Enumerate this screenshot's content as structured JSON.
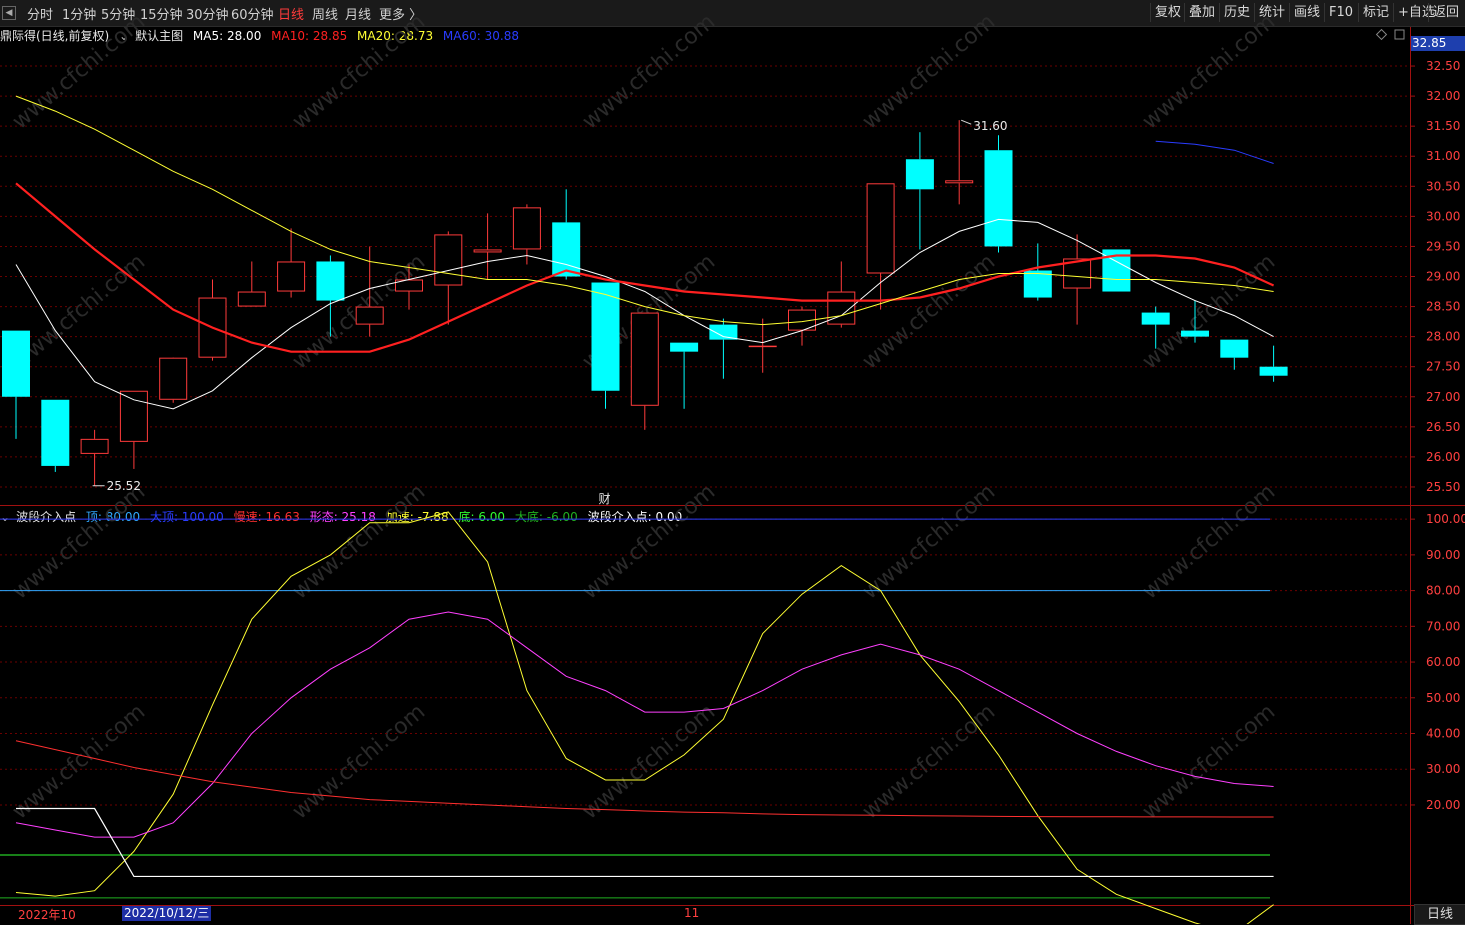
{
  "toolbar": {
    "periods": [
      "分时",
      "1分钟",
      "5分钟",
      "15分钟",
      "30分钟",
      "60分钟",
      "日线",
      "周线",
      "月线",
      "更多 〉"
    ],
    "active_period": "日线",
    "right_buttons": [
      "复权",
      "叠加",
      "历史",
      "统计",
      "画线",
      "F10",
      "标记",
      "+自选",
      "返回"
    ]
  },
  "main_legend": {
    "stock": "鼎际得(日线,前复权)",
    "template": "默认主图",
    "ma5": {
      "label": "MA5: 28.00",
      "color": "#ffffff"
    },
    "ma10": {
      "label": "MA10: 28.85",
      "color": "#ff2020"
    },
    "ma20": {
      "label": "MA20: 28.73",
      "color": "#ffff33"
    },
    "ma60": {
      "label": "MA60: 30.88",
      "color": "#2a3cff"
    }
  },
  "price_axis": {
    "current_price": "32.85",
    "ticks": [
      "32.50",
      "32.00",
      "31.50",
      "31.00",
      "30.50",
      "30.00",
      "29.50",
      "29.00",
      "28.50",
      "28.00",
      "27.50",
      "27.00",
      "26.50",
      "26.00",
      "25.50"
    ]
  },
  "annotations": {
    "high": "31.60",
    "low": "25.52",
    "finance_marker": "财"
  },
  "sub_legend": {
    "name": "波段介入点",
    "items": [
      {
        "label": "顶: 80.00",
        "color": "#30a8ff"
      },
      {
        "label": "大顶: 100.00",
        "color": "#2a3cff"
      },
      {
        "label": "慢速: 16.63",
        "color": "#ff3030"
      },
      {
        "label": "形态: 25.18",
        "color": "#ff40ff"
      },
      {
        "label": "加速: -7.88",
        "color": "#ffff33"
      },
      {
        "label": "底: 6.00",
        "color": "#30ff30"
      },
      {
        "label": "大底: -6.00",
        "color": "#20b020"
      },
      {
        "label": "波段介入点: 0.00",
        "color": "#ffffff"
      }
    ]
  },
  "sub_axis": {
    "ticks": [
      "100.00",
      "90.00",
      "80.00",
      "70.00",
      "60.00",
      "50.00",
      "40.00",
      "30.00",
      "20.00"
    ]
  },
  "date_axis": {
    "left_label": "2022年10",
    "cursor_date": "2022/10/12/三",
    "month_label": "11",
    "period_label": "日线"
  },
  "colors": {
    "up": "#ff3b3b",
    "down": "#00ffff",
    "grid": "#6b0000",
    "axis": "#a01010"
  },
  "watermark": "www.cfchi.com",
  "chart_data": [
    {
      "type": "candlestick",
      "title": "鼎际得(日线,前复权)",
      "ylim": [
        25.2,
        32.85
      ],
      "candles": [
        {
          "o": 28.1,
          "h": 28.1,
          "l": 26.3,
          "c": 27.0
        },
        {
          "o": 26.95,
          "h": 26.95,
          "l": 25.75,
          "c": 25.85
        },
        {
          "o": 26.05,
          "h": 26.45,
          "l": 25.52,
          "c": 26.3
        },
        {
          "o": 26.25,
          "h": 27.1,
          "l": 25.8,
          "c": 27.1
        },
        {
          "o": 26.95,
          "h": 27.6,
          "l": 26.9,
          "c": 27.65
        },
        {
          "o": 27.65,
          "h": 28.95,
          "l": 27.6,
          "c": 28.65
        },
        {
          "o": 28.5,
          "h": 29.25,
          "l": 28.5,
          "c": 28.75
        },
        {
          "o": 28.75,
          "h": 29.8,
          "l": 28.65,
          "c": 29.25
        },
        {
          "o": 29.25,
          "h": 29.35,
          "l": 28.0,
          "c": 28.6
        },
        {
          "o": 28.2,
          "h": 29.5,
          "l": 28.0,
          "c": 28.5
        },
        {
          "o": 28.75,
          "h": 29.2,
          "l": 28.45,
          "c": 28.95
        },
        {
          "o": 28.85,
          "h": 29.75,
          "l": 28.2,
          "c": 29.7
        },
        {
          "o": 29.4,
          "h": 30.05,
          "l": 28.95,
          "c": 29.45
        },
        {
          "o": 29.45,
          "h": 30.2,
          "l": 29.2,
          "c": 30.15
        },
        {
          "o": 29.9,
          "h": 30.45,
          "l": 28.95,
          "c": 29.0
        },
        {
          "o": 28.9,
          "h": 28.9,
          "l": 26.8,
          "c": 27.1
        },
        {
          "o": 26.85,
          "h": 28.4,
          "l": 26.45,
          "c": 28.4
        },
        {
          "o": 27.9,
          "h": 27.9,
          "l": 26.8,
          "c": 27.75
        },
        {
          "o": 28.2,
          "h": 28.3,
          "l": 27.3,
          "c": 27.95
        },
        {
          "o": 27.85,
          "h": 28.3,
          "l": 27.4,
          "c": 27.85
        },
        {
          "o": 28.1,
          "h": 28.5,
          "l": 27.85,
          "c": 28.45
        },
        {
          "o": 28.2,
          "h": 29.25,
          "l": 28.15,
          "c": 28.75
        },
        {
          "o": 29.05,
          "h": 30.55,
          "l": 28.45,
          "c": 30.55
        },
        {
          "o": 30.95,
          "h": 31.4,
          "l": 29.45,
          "c": 30.45
        },
        {
          "o": 30.55,
          "h": 31.6,
          "l": 30.2,
          "c": 30.6
        },
        {
          "o": 31.1,
          "h": 31.35,
          "l": 29.4,
          "c": 29.5
        },
        {
          "o": 29.1,
          "h": 29.55,
          "l": 28.6,
          "c": 28.65
        },
        {
          "o": 28.8,
          "h": 29.7,
          "l": 28.2,
          "c": 29.3
        },
        {
          "o": 29.45,
          "h": 29.45,
          "l": 28.75,
          "c": 28.75
        },
        {
          "o": 28.4,
          "h": 28.5,
          "l": 27.8,
          "c": 28.2
        },
        {
          "o": 28.1,
          "h": 28.6,
          "l": 27.9,
          "c": 28.0
        },
        {
          "o": 27.95,
          "h": 27.95,
          "l": 27.45,
          "c": 27.65
        },
        {
          "o": 27.5,
          "h": 27.85,
          "l": 27.25,
          "c": 27.35
        }
      ],
      "series": [
        {
          "name": "MA5",
          "color": "#ffffff",
          "values": [
            29.2,
            28.1,
            27.25,
            26.95,
            26.8,
            27.1,
            27.65,
            28.15,
            28.55,
            28.8,
            28.95,
            29.1,
            29.25,
            29.35,
            29.2,
            29.0,
            28.75,
            28.35,
            28.0,
            27.9,
            28.1,
            28.35,
            28.9,
            29.4,
            29.75,
            29.95,
            29.9,
            29.6,
            29.25,
            28.9,
            28.6,
            28.35,
            28.0
          ]
        },
        {
          "name": "MA10",
          "color": "#ff2020",
          "values": [
            30.55,
            30.0,
            29.45,
            28.95,
            28.45,
            28.15,
            27.9,
            27.75,
            27.75,
            27.75,
            27.95,
            28.25,
            28.55,
            28.85,
            29.1,
            28.95,
            28.85,
            28.75,
            28.7,
            28.65,
            28.6,
            28.6,
            28.6,
            28.65,
            28.8,
            29.0,
            29.15,
            29.25,
            29.35,
            29.35,
            29.3,
            29.15,
            28.85
          ]
        },
        {
          "name": "MA20",
          "color": "#ffff33",
          "values": [
            32.0,
            31.75,
            31.45,
            31.1,
            30.75,
            30.45,
            30.1,
            29.75,
            29.45,
            29.25,
            29.15,
            29.05,
            28.95,
            28.95,
            28.85,
            28.7,
            28.5,
            28.35,
            28.25,
            28.2,
            28.25,
            28.35,
            28.55,
            28.75,
            28.95,
            29.05,
            29.05,
            29.0,
            28.95,
            28.95,
            28.9,
            28.85,
            28.75
          ]
        },
        {
          "name": "MA60",
          "color": "#2a3cff",
          "values": [
            null,
            null,
            null,
            null,
            null,
            null,
            null,
            null,
            null,
            null,
            null,
            null,
            null,
            null,
            null,
            null,
            null,
            null,
            null,
            null,
            null,
            null,
            null,
            null,
            null,
            null,
            null,
            null,
            null,
            31.25,
            31.2,
            31.1,
            30.88
          ]
        }
      ]
    },
    {
      "type": "line",
      "title": "波段介入点",
      "ylim": [
        -8,
        102
      ],
      "hlines": [
        {
          "name": "顶",
          "value": 80,
          "color": "#30a8ff"
        },
        {
          "name": "大顶",
          "value": 100,
          "color": "#2a3cff"
        },
        {
          "name": "底",
          "value": 6,
          "color": "#30ff30"
        },
        {
          "name": "大底",
          "value": -6,
          "color": "#20b020"
        }
      ],
      "series": [
        {
          "name": "加速",
          "color": "#ffff33",
          "values": [
            -4.5,
            -5.5,
            -4,
            7,
            23,
            48,
            72,
            84,
            90,
            99,
            99,
            102,
            88,
            52,
            33,
            27,
            27,
            34,
            44,
            68,
            79,
            87,
            80,
            62,
            49,
            34,
            17,
            2,
            -5,
            -9,
            -13,
            -16,
            -7.88
          ]
        },
        {
          "name": "形态",
          "color": "#ff40ff",
          "values": [
            15,
            13,
            11,
            11,
            15,
            26,
            40,
            50,
            58,
            64,
            72,
            74,
            72,
            64,
            56,
            52,
            46,
            46,
            47,
            52,
            58,
            62,
            65,
            62,
            58,
            52,
            46,
            40,
            35,
            31,
            28,
            26,
            25.18
          ]
        },
        {
          "name": "慢速",
          "color": "#ff3030",
          "values": [
            38,
            35.5,
            33,
            30.5,
            28.5,
            26.5,
            25,
            23.5,
            22.5,
            21.5,
            21,
            20.5,
            20,
            19.5,
            19,
            18.7,
            18.3,
            18,
            17.8,
            17.5,
            17.3,
            17.2,
            17.1,
            17,
            16.9,
            16.8,
            16.75,
            16.7,
            16.68,
            16.66,
            16.65,
            16.64,
            16.63
          ]
        },
        {
          "name": "波段介入点",
          "color": "#ffffff",
          "values": [
            19,
            19,
            19,
            0,
            0,
            0,
            0,
            0,
            0,
            0,
            0,
            0,
            0,
            0,
            0,
            0,
            0,
            0,
            0,
            0,
            0,
            0,
            0,
            0,
            0,
            0,
            0,
            0,
            0,
            0,
            0,
            0,
            0
          ]
        }
      ]
    }
  ]
}
